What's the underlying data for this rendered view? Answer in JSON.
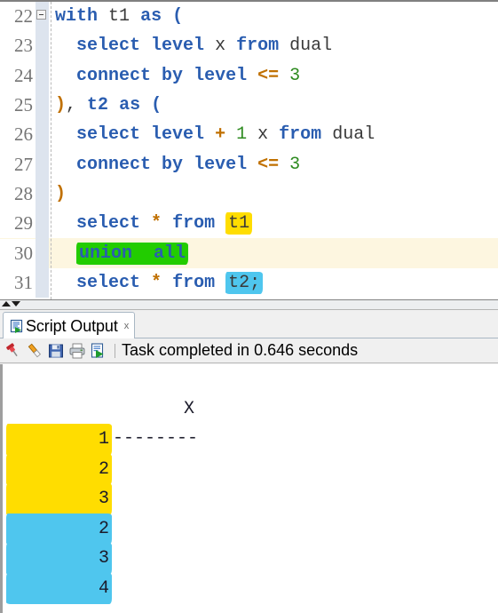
{
  "editor": {
    "name": "sql-editor",
    "current_line": 30,
    "lines": [
      {
        "number": "22",
        "fold": true,
        "tokens": [
          {
            "t": "with",
            "c": "kw"
          },
          {
            "t": " ",
            "c": "plain"
          },
          {
            "t": "t1",
            "c": "ident"
          },
          {
            "t": " ",
            "c": "plain"
          },
          {
            "t": "as",
            "c": "kw"
          },
          {
            "t": " ",
            "c": "plain"
          },
          {
            "t": "(",
            "c": "kw"
          }
        ]
      },
      {
        "number": "23",
        "fold": false,
        "tokens": [
          {
            "t": "  ",
            "c": "plain"
          },
          {
            "t": "select",
            "c": "kw"
          },
          {
            "t": " ",
            "c": "plain"
          },
          {
            "t": "level",
            "c": "kw"
          },
          {
            "t": " ",
            "c": "plain"
          },
          {
            "t": "x",
            "c": "ident"
          },
          {
            "t": " ",
            "c": "plain"
          },
          {
            "t": "from",
            "c": "kw"
          },
          {
            "t": " ",
            "c": "plain"
          },
          {
            "t": "dual",
            "c": "ident"
          }
        ]
      },
      {
        "number": "24",
        "fold": false,
        "tokens": [
          {
            "t": "  ",
            "c": "plain"
          },
          {
            "t": "connect",
            "c": "kw"
          },
          {
            "t": " ",
            "c": "plain"
          },
          {
            "t": "by",
            "c": "kw"
          },
          {
            "t": " ",
            "c": "plain"
          },
          {
            "t": "level",
            "c": "kw"
          },
          {
            "t": " ",
            "c": "plain"
          },
          {
            "t": "<=",
            "c": "op"
          },
          {
            "t": " ",
            "c": "plain"
          },
          {
            "t": "3",
            "c": "num"
          }
        ]
      },
      {
        "number": "25",
        "fold": false,
        "tokens": [
          {
            "t": ")",
            "c": "op"
          },
          {
            "t": ", ",
            "c": "plain"
          },
          {
            "t": "t2",
            "c": "kw"
          },
          {
            "t": " ",
            "c": "plain"
          },
          {
            "t": "as",
            "c": "kw"
          },
          {
            "t": " ",
            "c": "plain"
          },
          {
            "t": "(",
            "c": "kw"
          }
        ]
      },
      {
        "number": "26",
        "fold": false,
        "tokens": [
          {
            "t": "  ",
            "c": "plain"
          },
          {
            "t": "select",
            "c": "kw"
          },
          {
            "t": " ",
            "c": "plain"
          },
          {
            "t": "level",
            "c": "kw"
          },
          {
            "t": " ",
            "c": "plain"
          },
          {
            "t": "+",
            "c": "op"
          },
          {
            "t": " ",
            "c": "plain"
          },
          {
            "t": "1",
            "c": "num"
          },
          {
            "t": " ",
            "c": "plain"
          },
          {
            "t": "x",
            "c": "ident"
          },
          {
            "t": " ",
            "c": "plain"
          },
          {
            "t": "from",
            "c": "kw"
          },
          {
            "t": " ",
            "c": "plain"
          },
          {
            "t": "dual",
            "c": "ident"
          }
        ]
      },
      {
        "number": "27",
        "fold": false,
        "tokens": [
          {
            "t": "  ",
            "c": "plain"
          },
          {
            "t": "connect",
            "c": "kw"
          },
          {
            "t": " ",
            "c": "plain"
          },
          {
            "t": "by",
            "c": "kw"
          },
          {
            "t": " ",
            "c": "plain"
          },
          {
            "t": "level",
            "c": "kw"
          },
          {
            "t": " ",
            "c": "plain"
          },
          {
            "t": "<=",
            "c": "op"
          },
          {
            "t": " ",
            "c": "plain"
          },
          {
            "t": "3",
            "c": "num"
          }
        ]
      },
      {
        "number": "28",
        "fold": false,
        "tokens": [
          {
            "t": ")",
            "c": "op"
          }
        ]
      },
      {
        "number": "29",
        "fold": false,
        "tokens": [
          {
            "t": "  ",
            "c": "plain"
          },
          {
            "t": "select",
            "c": "kw"
          },
          {
            "t": " ",
            "c": "plain"
          },
          {
            "t": "*",
            "c": "op"
          },
          {
            "t": " ",
            "c": "plain"
          },
          {
            "t": "from",
            "c": "kw"
          },
          {
            "t": " ",
            "c": "plain"
          },
          {
            "t": "t1",
            "c": "ident",
            "hl": "yellow"
          }
        ]
      },
      {
        "number": "30",
        "fold": false,
        "tokens": [
          {
            "t": "  ",
            "c": "plain"
          },
          {
            "t": "union  all",
            "c": "kw",
            "hl": "green"
          }
        ]
      },
      {
        "number": "31",
        "fold": false,
        "tokens": [
          {
            "t": "  ",
            "c": "plain"
          },
          {
            "t": "select",
            "c": "kw"
          },
          {
            "t": " ",
            "c": "plain"
          },
          {
            "t": "*",
            "c": "op"
          },
          {
            "t": " ",
            "c": "plain"
          },
          {
            "t": "from",
            "c": "kw"
          },
          {
            "t": " ",
            "c": "plain"
          },
          {
            "t": "t2;",
            "c": "ident",
            "hl": "cyan"
          }
        ]
      }
    ]
  },
  "output_panel": {
    "tab": {
      "label": "Script Output",
      "close_label": "x",
      "icon": "script-output-icon"
    },
    "toolbar": {
      "buttons": [
        {
          "name": "pin-button",
          "icon": "pushpin-icon",
          "title": "Pin"
        },
        {
          "name": "clear-button",
          "icon": "eraser-icon",
          "title": "Clear"
        },
        {
          "name": "save-button",
          "icon": "floppy-disk-icon",
          "title": "Save"
        },
        {
          "name": "print-button",
          "icon": "printer-icon",
          "title": "Print"
        },
        {
          "name": "run-button",
          "icon": "run-script-icon",
          "title": "Run Script"
        }
      ],
      "status": "Task completed in 0.646 seconds"
    },
    "result": {
      "header": "X",
      "separator": "----------",
      "rows": [
        {
          "value": "1",
          "hl": "yellow"
        },
        {
          "value": "2",
          "hl": "yellow"
        },
        {
          "value": "3",
          "hl": "yellow"
        },
        {
          "value": "2",
          "hl": "cyan"
        },
        {
          "value": "3",
          "hl": "cyan"
        },
        {
          "value": "4",
          "hl": "cyan"
        }
      ]
    }
  },
  "colors": {
    "highlight_yellow": "#ffdd00",
    "highlight_green": "#22cc00",
    "highlight_cyan": "#4fc6ee",
    "current_line_bg": "#fdf6e0",
    "keyword_blue": "#2a5db0",
    "number_green": "#2e8b20",
    "operator_orange": "#c07000",
    "gutter_blue": "#dde4ee"
  }
}
